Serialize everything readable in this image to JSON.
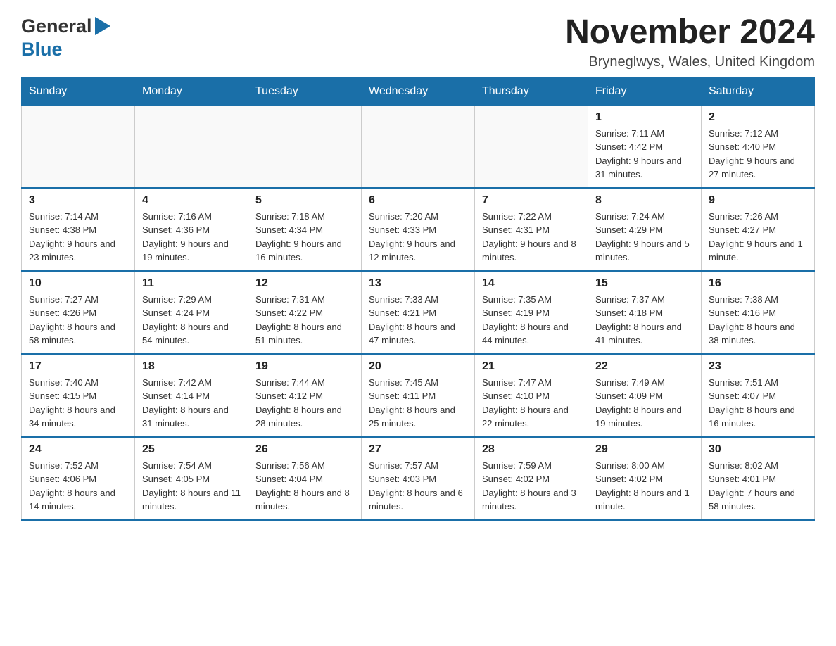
{
  "header": {
    "logo_general": "General",
    "logo_blue": "Blue",
    "main_title": "November 2024",
    "subtitle": "Bryneglwys, Wales, United Kingdom"
  },
  "calendar": {
    "weekdays": [
      "Sunday",
      "Monday",
      "Tuesday",
      "Wednesday",
      "Thursday",
      "Friday",
      "Saturday"
    ],
    "weeks": [
      [
        {
          "day": "",
          "info": ""
        },
        {
          "day": "",
          "info": ""
        },
        {
          "day": "",
          "info": ""
        },
        {
          "day": "",
          "info": ""
        },
        {
          "day": "",
          "info": ""
        },
        {
          "day": "1",
          "info": "Sunrise: 7:11 AM\nSunset: 4:42 PM\nDaylight: 9 hours and 31 minutes."
        },
        {
          "day": "2",
          "info": "Sunrise: 7:12 AM\nSunset: 4:40 PM\nDaylight: 9 hours and 27 minutes."
        }
      ],
      [
        {
          "day": "3",
          "info": "Sunrise: 7:14 AM\nSunset: 4:38 PM\nDaylight: 9 hours and 23 minutes."
        },
        {
          "day": "4",
          "info": "Sunrise: 7:16 AM\nSunset: 4:36 PM\nDaylight: 9 hours and 19 minutes."
        },
        {
          "day": "5",
          "info": "Sunrise: 7:18 AM\nSunset: 4:34 PM\nDaylight: 9 hours and 16 minutes."
        },
        {
          "day": "6",
          "info": "Sunrise: 7:20 AM\nSunset: 4:33 PM\nDaylight: 9 hours and 12 minutes."
        },
        {
          "day": "7",
          "info": "Sunrise: 7:22 AM\nSunset: 4:31 PM\nDaylight: 9 hours and 8 minutes."
        },
        {
          "day": "8",
          "info": "Sunrise: 7:24 AM\nSunset: 4:29 PM\nDaylight: 9 hours and 5 minutes."
        },
        {
          "day": "9",
          "info": "Sunrise: 7:26 AM\nSunset: 4:27 PM\nDaylight: 9 hours and 1 minute."
        }
      ],
      [
        {
          "day": "10",
          "info": "Sunrise: 7:27 AM\nSunset: 4:26 PM\nDaylight: 8 hours and 58 minutes."
        },
        {
          "day": "11",
          "info": "Sunrise: 7:29 AM\nSunset: 4:24 PM\nDaylight: 8 hours and 54 minutes."
        },
        {
          "day": "12",
          "info": "Sunrise: 7:31 AM\nSunset: 4:22 PM\nDaylight: 8 hours and 51 minutes."
        },
        {
          "day": "13",
          "info": "Sunrise: 7:33 AM\nSunset: 4:21 PM\nDaylight: 8 hours and 47 minutes."
        },
        {
          "day": "14",
          "info": "Sunrise: 7:35 AM\nSunset: 4:19 PM\nDaylight: 8 hours and 44 minutes."
        },
        {
          "day": "15",
          "info": "Sunrise: 7:37 AM\nSunset: 4:18 PM\nDaylight: 8 hours and 41 minutes."
        },
        {
          "day": "16",
          "info": "Sunrise: 7:38 AM\nSunset: 4:16 PM\nDaylight: 8 hours and 38 minutes."
        }
      ],
      [
        {
          "day": "17",
          "info": "Sunrise: 7:40 AM\nSunset: 4:15 PM\nDaylight: 8 hours and 34 minutes."
        },
        {
          "day": "18",
          "info": "Sunrise: 7:42 AM\nSunset: 4:14 PM\nDaylight: 8 hours and 31 minutes."
        },
        {
          "day": "19",
          "info": "Sunrise: 7:44 AM\nSunset: 4:12 PM\nDaylight: 8 hours and 28 minutes."
        },
        {
          "day": "20",
          "info": "Sunrise: 7:45 AM\nSunset: 4:11 PM\nDaylight: 8 hours and 25 minutes."
        },
        {
          "day": "21",
          "info": "Sunrise: 7:47 AM\nSunset: 4:10 PM\nDaylight: 8 hours and 22 minutes."
        },
        {
          "day": "22",
          "info": "Sunrise: 7:49 AM\nSunset: 4:09 PM\nDaylight: 8 hours and 19 minutes."
        },
        {
          "day": "23",
          "info": "Sunrise: 7:51 AM\nSunset: 4:07 PM\nDaylight: 8 hours and 16 minutes."
        }
      ],
      [
        {
          "day": "24",
          "info": "Sunrise: 7:52 AM\nSunset: 4:06 PM\nDaylight: 8 hours and 14 minutes."
        },
        {
          "day": "25",
          "info": "Sunrise: 7:54 AM\nSunset: 4:05 PM\nDaylight: 8 hours and 11 minutes."
        },
        {
          "day": "26",
          "info": "Sunrise: 7:56 AM\nSunset: 4:04 PM\nDaylight: 8 hours and 8 minutes."
        },
        {
          "day": "27",
          "info": "Sunrise: 7:57 AM\nSunset: 4:03 PM\nDaylight: 8 hours and 6 minutes."
        },
        {
          "day": "28",
          "info": "Sunrise: 7:59 AM\nSunset: 4:02 PM\nDaylight: 8 hours and 3 minutes."
        },
        {
          "day": "29",
          "info": "Sunrise: 8:00 AM\nSunset: 4:02 PM\nDaylight: 8 hours and 1 minute."
        },
        {
          "day": "30",
          "info": "Sunrise: 8:02 AM\nSunset: 4:01 PM\nDaylight: 7 hours and 58 minutes."
        }
      ]
    ]
  }
}
